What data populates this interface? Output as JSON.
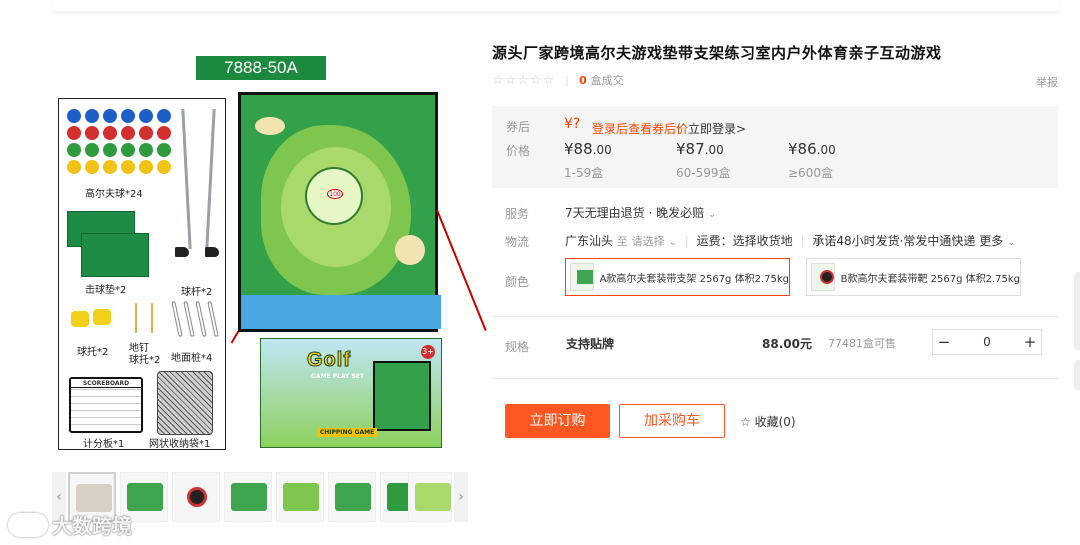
{
  "gallery": {
    "model_badge": "7888-50A",
    "parts": {
      "balls_label": "高尔夫球*24",
      "mat_label": "击球垫*2",
      "club_label": "球杆*2",
      "tee_label": "球托*2",
      "peg_label": "地钉\n球托*2",
      "stake_label": "地面桩*4",
      "scoreboard_label": "计分板*1",
      "scoreboard_title": "SCOREBOARD",
      "netbag_label": "网状收纳袋*1"
    },
    "target_hole_number": "100",
    "box": {
      "title": "Golf",
      "subtitle": "GAME PLAY SET",
      "footer": "CHIPPING GAME",
      "badge": "3+"
    },
    "thumb_prev": "‹",
    "thumb_next": "›",
    "thumbnail_count": 8
  },
  "watermark": "大数跨境",
  "product": {
    "title": "源头厂家跨境高尔夫游戏垫带支架练习室内户外体育亲子互动游戏",
    "stars": "☆☆☆☆☆",
    "sold_count": "0",
    "sold_unit": "盒成交",
    "report": "举报"
  },
  "pricing": {
    "coupon_label": "券后",
    "coupon_icon": "¥?",
    "coupon_text": "登录后查看券后价",
    "coupon_login": "立即登录>",
    "price_label": "价格",
    "tiers": [
      {
        "price_main": "¥88",
        "price_dec": ".00",
        "range": "1-59盒"
      },
      {
        "price_main": "¥87",
        "price_dec": ".00",
        "range": "60-599盒"
      },
      {
        "price_main": "¥86",
        "price_dec": ".00",
        "range": "≥600盒"
      }
    ]
  },
  "service": {
    "label": "服务",
    "text": "7天无理由退货 · 晚发必赔",
    "chevron": "⌄"
  },
  "logistics": {
    "label": "物流",
    "origin": "广东汕头",
    "to": "至",
    "select_hint": "请选择",
    "fee": "运费：选择收货地",
    "promise": "承诺48小时发货·常发中通快递",
    "more": "更多"
  },
  "colors": {
    "label": "颜色",
    "options": [
      {
        "text": "A款高尔夫套装带支架 2567g 体积2.75kg",
        "selected": true
      },
      {
        "text": "B款高尔夫套装带靶 2567g 体积2.75kg",
        "selected": false
      }
    ]
  },
  "spec": {
    "label": "规格",
    "name": "支持贴牌",
    "price": "88.00元",
    "stock": "77481盒可售",
    "minus": "−",
    "qty": "0",
    "plus": "+"
  },
  "actions": {
    "order": "立即订购",
    "cart": "加采购车",
    "fav_icon": "☆",
    "fav": "收藏(0)"
  },
  "theme": {
    "accent": "#ff5722",
    "badge_green": "#1b8a3e"
  }
}
